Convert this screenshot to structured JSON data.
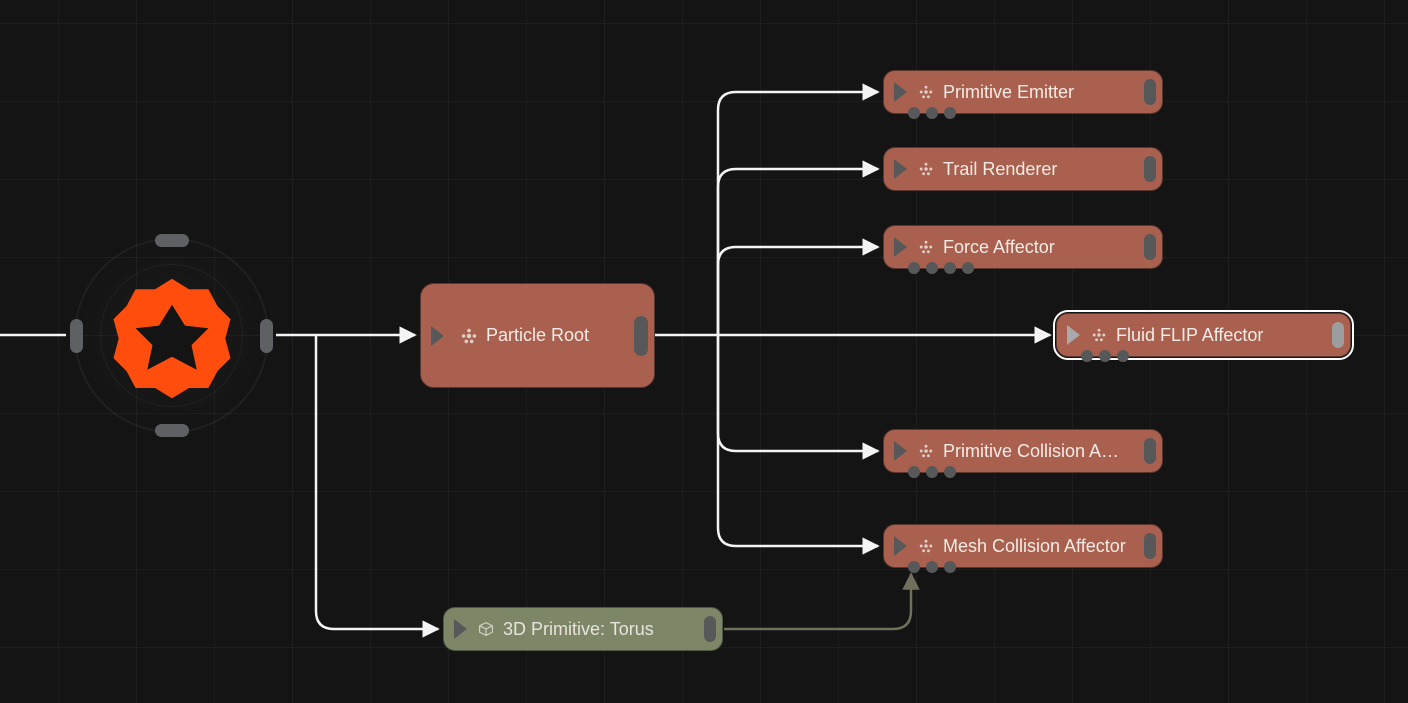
{
  "root": {
    "kind": "scene-root"
  },
  "particle_root": {
    "label": "Particle Root"
  },
  "children": [
    {
      "label": "Primitive Emitter"
    },
    {
      "label": "Trail Renderer"
    },
    {
      "label": "Force Affector"
    },
    {
      "label": "Fluid FLIP Affector",
      "selected": true
    },
    {
      "label": "Primitive Collision Aff..."
    },
    {
      "label": "Mesh Collision Affector"
    }
  ],
  "primitive": {
    "label": "3D Primitive: Torus"
  },
  "colors": {
    "node_brown": "#aa604f",
    "node_green": "#7d8768",
    "root_logo": "#ff4d0d",
    "edge": "#f4f4f4",
    "edge_dim": "#6e705a",
    "port": "#57585a"
  }
}
